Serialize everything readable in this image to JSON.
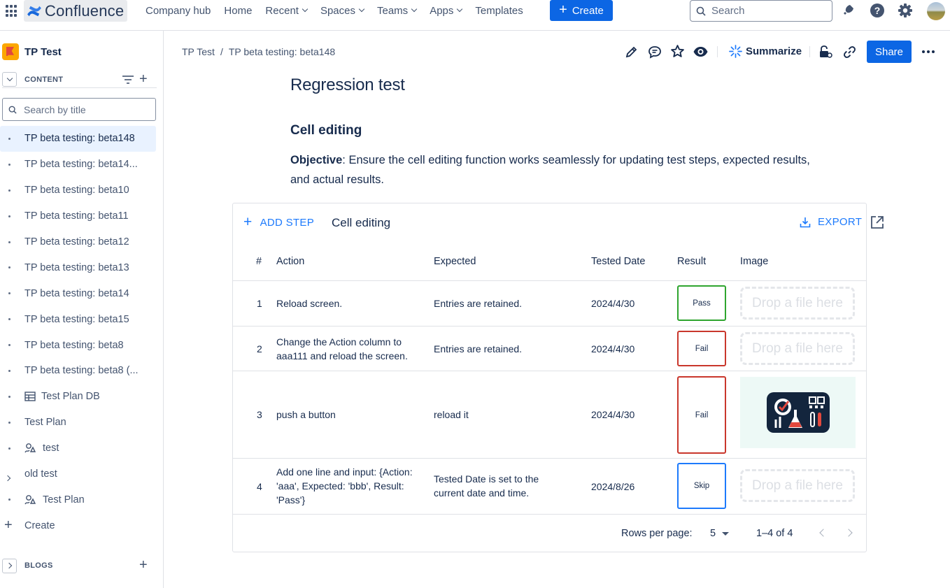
{
  "topnav": {
    "logo_text": "Confluence",
    "items": [
      {
        "label": "Company hub",
        "dropdown": false
      },
      {
        "label": "Home",
        "dropdown": false
      },
      {
        "label": "Recent",
        "dropdown": true
      },
      {
        "label": "Spaces",
        "dropdown": true
      },
      {
        "label": "Teams",
        "dropdown": true
      },
      {
        "label": "Apps",
        "dropdown": true
      },
      {
        "label": "Templates",
        "dropdown": false
      }
    ],
    "create_label": "Create",
    "search_placeholder": "Search",
    "icons": [
      "notifications-icon",
      "help-icon",
      "settings-icon",
      "avatar"
    ]
  },
  "sidebar": {
    "space_name": "TP Test",
    "content_label": "CONTENT",
    "search_placeholder": "Search by title",
    "items": [
      {
        "label": "TP beta testing: beta148",
        "selected": true,
        "icon": "bullet"
      },
      {
        "label": "TP beta testing: beta14...",
        "icon": "bullet"
      },
      {
        "label": "TP beta testing: beta10",
        "icon": "bullet"
      },
      {
        "label": "TP beta testing: beta11",
        "icon": "bullet"
      },
      {
        "label": "TP beta testing: beta12",
        "icon": "bullet"
      },
      {
        "label": "TP beta testing: beta13",
        "icon": "bullet"
      },
      {
        "label": "TP beta testing: beta14",
        "icon": "bullet"
      },
      {
        "label": "TP beta testing: beta15",
        "icon": "bullet"
      },
      {
        "label": "TP beta testing: beta8",
        "icon": "bullet"
      },
      {
        "label": "TP beta testing: beta8 (...",
        "icon": "bullet"
      },
      {
        "label": "Test Plan DB",
        "icon": "database-icon"
      },
      {
        "label": "Test Plan",
        "icon": "bullet"
      },
      {
        "label": "test",
        "icon": "whiteboard-icon"
      },
      {
        "label": "old test",
        "icon": "chevron-right"
      },
      {
        "label": "Test Plan",
        "icon": "whiteboard-icon"
      },
      {
        "label": "Create",
        "icon": "plus"
      }
    ],
    "blogs_label": "BLOGS"
  },
  "breadcrumb": [
    "TP Test",
    "TP beta testing: beta148"
  ],
  "page_actions": {
    "summarize_label": "Summarize",
    "share_label": "Share"
  },
  "page": {
    "title": "Regression test",
    "section_heading": "Cell editing",
    "objective_label": "Objective",
    "objective_text": ": Ensure the cell editing function works seamlessly for updating test steps, expected results, and actual results."
  },
  "test_table": {
    "add_step_label": "ADD STEP",
    "title": "Cell editing",
    "export_label": "EXPORT",
    "columns": [
      "#",
      "Action",
      "Expected",
      "Tested Date",
      "Result",
      "Image"
    ],
    "rows": [
      {
        "num": "1",
        "action": "Reload screen.",
        "expected": "Entries are retained.",
        "date": "2024/4/30",
        "result": "Pass",
        "image": "Drop a file here"
      },
      {
        "num": "2",
        "action": "Change the Action column to aaa111 and reload the screen.",
        "expected": "Entries are retained.",
        "date": "2024/4/30",
        "result": "Fail",
        "image": "Drop a file here"
      },
      {
        "num": "3",
        "action": "push a button",
        "expected": "reload it",
        "date": "2024/4/30",
        "result": "Fail",
        "image": "test-plan-logo-image"
      },
      {
        "num": "4",
        "action": "Add one line and input: {Action: 'aaa', Expected: 'bbb', Result: 'Pass'}",
        "expected": "Tested Date is set to the current date and time.",
        "date": "2024/8/26",
        "result": "Skip",
        "image": "Drop a file here"
      }
    ],
    "rows_per_page_label": "Rows per page:",
    "rows_per_page_value": "5",
    "range_label": "1–4 of 4"
  },
  "colors": {
    "brand_blue": "#0c66e4",
    "link_blue": "#1d7afc",
    "pass_green": "#2fa52f",
    "fail_red": "#c9372c",
    "skip_blue": "#1d7afc",
    "selected_bg": "#e9f2ff"
  }
}
